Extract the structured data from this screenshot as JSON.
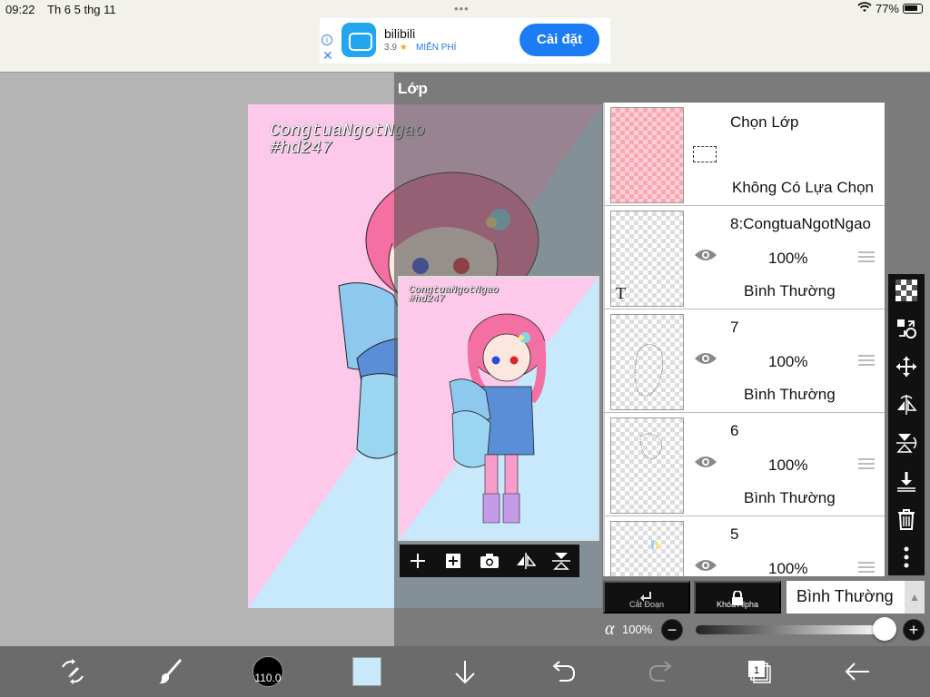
{
  "status": {
    "time": "09:22",
    "date": "Th 6 5 thg 11",
    "battery_text": "77%"
  },
  "ad": {
    "app_name": "bilibili",
    "rating": "3.9",
    "price": "MIỄN PHÍ",
    "install_label": "Cài đặt",
    "info_glyph": "i",
    "close_glyph": "✕"
  },
  "artwork": {
    "watermark_line1": "CongtuaNgotNgao",
    "watermark_line2": "#hd247",
    "bg_pink": "#fcc9ea",
    "bg_blue": "#c8e8fb"
  },
  "layer_panel": {
    "title": "Lớp",
    "selection_layer": {
      "name": "Chọn Lớp",
      "status": "Không Có Lựa Chọn"
    },
    "layers": [
      {
        "name": "8:CongtuaNgotNgao",
        "opacity": "100%",
        "blend": "Bình Thường",
        "type": "text",
        "type_mark": "T"
      },
      {
        "name": "7",
        "opacity": "100%",
        "blend": "Bình Thường",
        "type": "raster"
      },
      {
        "name": "6",
        "opacity": "100%",
        "blend": "Bình Thường",
        "type": "raster"
      },
      {
        "name": "5",
        "opacity": "100%",
        "blend": "Bình Thường",
        "type": "raster"
      }
    ],
    "clipping_label": "Cắt Đoạn",
    "alpha_lock_label": "Khóa Alpha",
    "blend_mode": "Bình Thường",
    "alpha_symbol": "α",
    "alpha_value": "100%",
    "alpha_fraction": 1.0
  },
  "toolbar": {
    "brush_size": "110.0",
    "current_color": "#c8e8fb",
    "layer_count": "1"
  },
  "icons": {
    "status": [
      "wifi-icon",
      "battery-icon"
    ],
    "preview_toolbar": [
      "add-layer-icon",
      "add-copy-layer-icon",
      "camera-icon",
      "flip-horizontal-icon",
      "flip-vertical-icon"
    ],
    "right_tools": [
      "transparency-icon",
      "transform-icon",
      "move-icon",
      "flip-h-icon",
      "flip-v-icon",
      "merge-down-icon",
      "trash-icon",
      "more-icon"
    ],
    "bottom": [
      "transform-tool-icon",
      "brush-icon",
      "brush-size-icon",
      "color-swatch-icon",
      "download-icon",
      "undo-icon",
      "redo-icon",
      "layers-icon",
      "back-icon"
    ]
  }
}
